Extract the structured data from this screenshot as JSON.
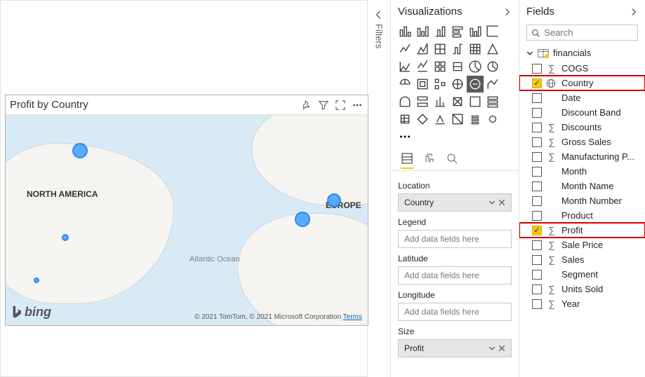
{
  "canvas": {
    "visual_title": "Profit by Country",
    "bing_logo": "bing",
    "attribution": "© 2021 TomTom, © 2021 Microsoft Corporation ",
    "attribution_link": "Terms",
    "map_labels": {
      "na": "NORTH AMERICA",
      "eu": "EUROPE",
      "atlantic": "Atlantic\nOcean"
    }
  },
  "filters": {
    "label": "Filters"
  },
  "viz": {
    "title": "Visualizations",
    "fieldwells": [
      {
        "label": "Location",
        "value": "Country",
        "placeholder": "",
        "filled": true
      },
      {
        "label": "Legend",
        "value": "",
        "placeholder": "Add data fields here",
        "filled": false
      },
      {
        "label": "Latitude",
        "value": "",
        "placeholder": "Add data fields here",
        "filled": false
      },
      {
        "label": "Longitude",
        "value": "",
        "placeholder": "Add data fields here",
        "filled": false
      },
      {
        "label": "Size",
        "value": "Profit",
        "placeholder": "",
        "filled": true
      }
    ],
    "selected_icon_index": 22
  },
  "fields": {
    "title": "Fields",
    "search_placeholder": "Search",
    "table": "financials",
    "items": [
      {
        "name": "COGS",
        "icon": "sigma",
        "checked": false,
        "highlight": false
      },
      {
        "name": "Country",
        "icon": "globe",
        "checked": true,
        "highlight": true
      },
      {
        "name": "Date",
        "icon": "",
        "checked": false,
        "highlight": false
      },
      {
        "name": "Discount Band",
        "icon": "",
        "checked": false,
        "highlight": false
      },
      {
        "name": "Discounts",
        "icon": "sigma",
        "checked": false,
        "highlight": false
      },
      {
        "name": "Gross Sales",
        "icon": "sigma",
        "checked": false,
        "highlight": false
      },
      {
        "name": "Manufacturing P...",
        "icon": "sigma",
        "checked": false,
        "highlight": false
      },
      {
        "name": "Month",
        "icon": "",
        "checked": false,
        "highlight": false
      },
      {
        "name": "Month Name",
        "icon": "",
        "checked": false,
        "highlight": false
      },
      {
        "name": "Month Number",
        "icon": "",
        "checked": false,
        "highlight": false
      },
      {
        "name": "Product",
        "icon": "",
        "checked": false,
        "highlight": false
      },
      {
        "name": "Profit",
        "icon": "sigma",
        "checked": true,
        "highlight": true
      },
      {
        "name": "Sale Price",
        "icon": "sigma",
        "checked": false,
        "highlight": false
      },
      {
        "name": "Sales",
        "icon": "sigma",
        "checked": false,
        "highlight": false
      },
      {
        "name": "Segment",
        "icon": "",
        "checked": false,
        "highlight": false
      },
      {
        "name": "Units Sold",
        "icon": "sigma",
        "checked": false,
        "highlight": false
      },
      {
        "name": "Year",
        "icon": "sigma",
        "checked": false,
        "highlight": false
      }
    ]
  }
}
